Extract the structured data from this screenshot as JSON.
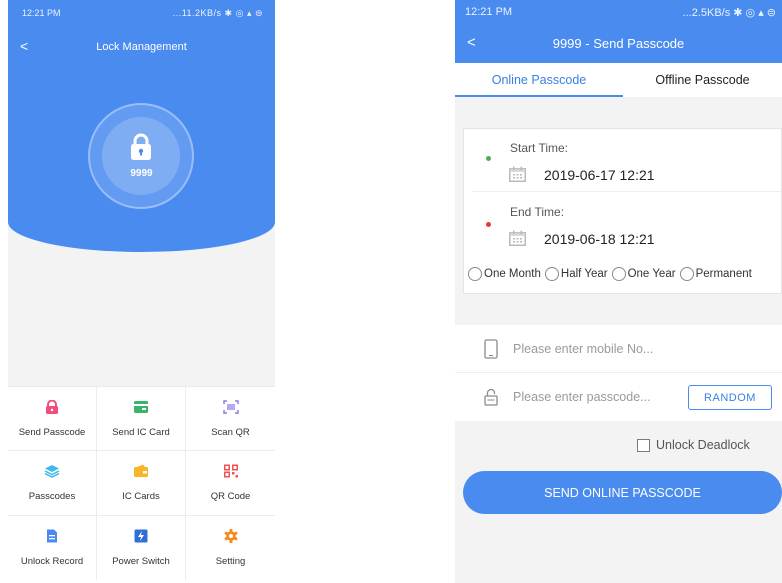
{
  "left": {
    "status": {
      "time": "12:21 PM",
      "indicators": "...11.2KB/s ✱ ◎ ▴ ⊜"
    },
    "header": {
      "back": "<",
      "title": "Lock Management"
    },
    "lock": {
      "name": "9999",
      "icon": "lock-icon"
    },
    "grid": [
      {
        "label": "Send Passcode",
        "icon": "send-passcode-icon",
        "color": "#ef4f7e"
      },
      {
        "label": "Send IC Card",
        "icon": "ic-card-icon",
        "color": "#3bb36a"
      },
      {
        "label": "Scan QR",
        "icon": "scan-qr-icon",
        "color": "#8e7ae0"
      },
      {
        "label": "Passcodes",
        "icon": "passcodes-icon",
        "color": "#3fb9ec"
      },
      {
        "label": "IC Cards",
        "icon": "ic-cards-icon",
        "color": "#f7b52b"
      },
      {
        "label": "QR Code",
        "icon": "qr-code-icon",
        "color": "#ef5350"
      },
      {
        "label": "Unlock Record",
        "icon": "unlock-record-icon",
        "color": "#4a8bf0"
      },
      {
        "label": "Power Switch",
        "icon": "power-switch-icon",
        "color": "#2f6fd6"
      },
      {
        "label": "Setting",
        "icon": "gear-icon",
        "color": "#f58a1f"
      }
    ]
  },
  "right": {
    "status": {
      "time": "12:21 PM",
      "indicators": "...2.5KB/s ✱ ◎ ▴ ⊜"
    },
    "header": {
      "back": "<",
      "title": "9999 - Send Passcode"
    },
    "tabs": [
      {
        "label": "Online Passcode",
        "active": true
      },
      {
        "label": "Offline Passcode",
        "active": false
      }
    ],
    "start": {
      "label": "Start Time:",
      "value": "2019-06-17 12:21"
    },
    "end": {
      "label": "End Time:",
      "value": "2019-06-18 12:21"
    },
    "durations": [
      "One Month",
      "Half Year",
      "One Year",
      "Permanent"
    ],
    "phone": {
      "placeholder": "Please enter mobile No..."
    },
    "passcode": {
      "placeholder": "Please enter passcode..."
    },
    "random_label": "RANDOM",
    "deadlock_label": "Unlock Deadlock",
    "send_label": "SEND ONLINE PASSCODE"
  },
  "colors": {
    "primary": "#4a8bf0",
    "start_dot": "#4caf50",
    "end_dot": "#e53935"
  }
}
